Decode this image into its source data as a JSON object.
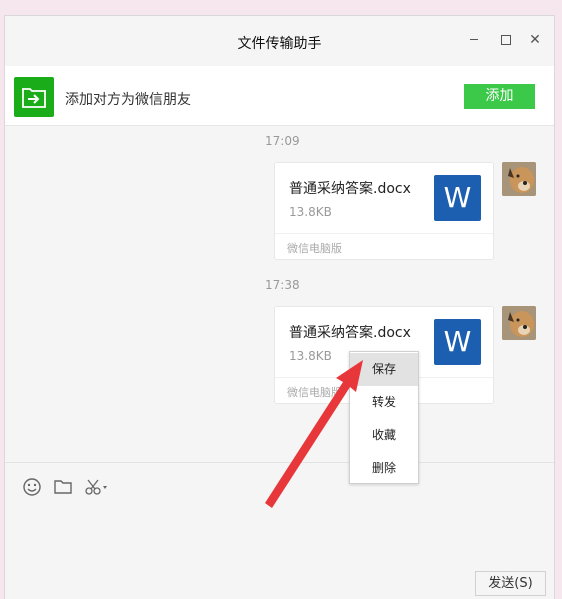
{
  "window": {
    "title": "文件传输助手"
  },
  "banner": {
    "text": "添加对方为微信朋友",
    "add_label": "添加"
  },
  "messages": [
    {
      "time": "17:09",
      "file_name": "普通采纳答案.docx",
      "size": "13.8KB",
      "source": "微信电脑版",
      "icon_letter": "W"
    },
    {
      "time": "17:38",
      "file_name": "普通采纳答案.docx",
      "size": "13.8KB",
      "source": "微信电脑版",
      "icon_letter": "W"
    }
  ],
  "context_menu": {
    "items": [
      "保存",
      "转发",
      "收藏",
      "删除"
    ]
  },
  "input": {
    "send_label": "发送(S)"
  },
  "colors": {
    "accent_green": "#3cc94a",
    "word_blue": "#1c5fb0",
    "arrow_red": "#e8373a"
  },
  "icons": [
    "file-transfer-icon",
    "emoji-icon",
    "folder-icon",
    "scissors-icon",
    "word-file-icon",
    "minimize-icon",
    "maximize-icon",
    "close-icon"
  ]
}
